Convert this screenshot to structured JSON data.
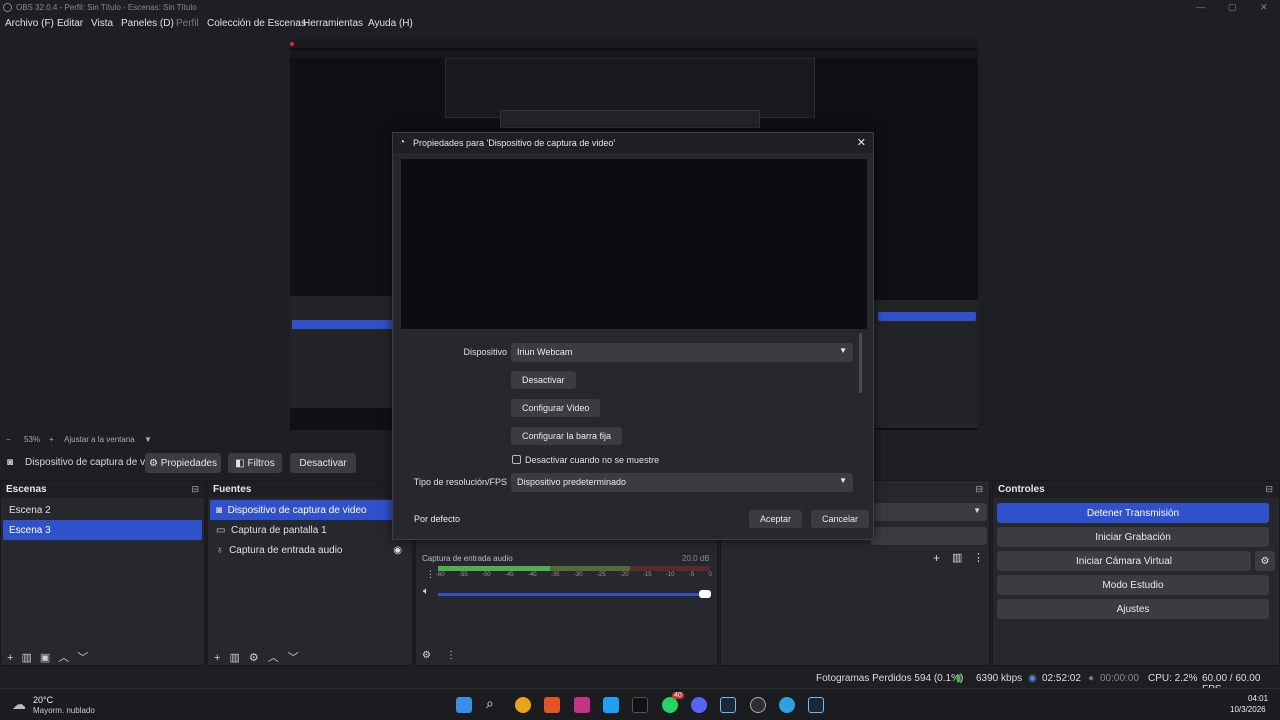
{
  "window": {
    "title": "OBS 32.0.4 - Perfil: Sin Título - Escenas: Sin Título"
  },
  "menu": [
    "Archivo (F)",
    "Editar",
    "Vista",
    "Paneles (D)",
    "Perfil",
    "Colección de Escenas",
    "Herramientas",
    "Ayuda (H)"
  ],
  "preview_bar": {
    "zoom": "53%",
    "fit_label": "Ajustar a la ventana"
  },
  "source_toolbar": {
    "current_source": "Dispositivo de captura de v",
    "properties": "Propiedades",
    "filters": "Filtros",
    "deactivate": "Desactivar"
  },
  "scenes": {
    "title": "Escenas",
    "items": [
      "Escena 2",
      "Escena 3"
    ],
    "selected": 1
  },
  "sources": {
    "title": "Fuentes",
    "items": [
      {
        "label": "Dispositivo de captura de video",
        "icon": "camera-icon"
      },
      {
        "label": "Captura de pantalla 1",
        "icon": "monitor-icon"
      },
      {
        "label": "Captura de entrada audio",
        "icon": "microphone-icon"
      }
    ],
    "selected": 0
  },
  "mixer": {
    "channel": "Captura de entrada audio",
    "db": "20.0 dB",
    "scale": [
      "-60",
      "-55",
      "-50",
      "-45",
      "-40",
      "-35",
      "-30",
      "-25",
      "-20",
      "-15",
      "-10",
      "-5",
      "0"
    ]
  },
  "controls": {
    "title": "Controles",
    "buttons": [
      "Detener Transmisión",
      "Iniciar Grabación",
      "Iniciar Cámara Virtual",
      "Modo Estudio",
      "Ajustes"
    ]
  },
  "status": {
    "dropped": "Fotogramas Perdidos 594 (0.1%)",
    "bitrate": "6390 kbps",
    "stream_time": "02:52:02",
    "rec_time": "00:00:00",
    "cpu": "CPU: 2.2%",
    "fps": "60.00 / 60.00 FPS"
  },
  "dialog": {
    "title": "Propiedades para 'Dispositivo de captura de video'",
    "device_label": "Dispositivo",
    "device_value": "Iriun Webcam",
    "deactivate": "Desactivar",
    "configure_video": "Configurar Video",
    "configure_bar": "Configurar la barra fija",
    "checkbox_label": "Desactivar cuando no se muestre",
    "res_label": "Tipo de resolución/FPS",
    "res_value": "Dispositivo predeterminado",
    "defaults": "Por defecto",
    "accept": "Aceptar",
    "cancel": "Cancelar"
  },
  "taskbar": {
    "weather_temp": "20°C",
    "weather_desc": "Mayorm. nublado",
    "time": "04:01",
    "date": "10/3/2026",
    "badge": "40"
  },
  "colors": {
    "accent": "#2f51cb",
    "bg": "#1e1f22",
    "panel": "#26282d",
    "button": "#3a3c41"
  }
}
